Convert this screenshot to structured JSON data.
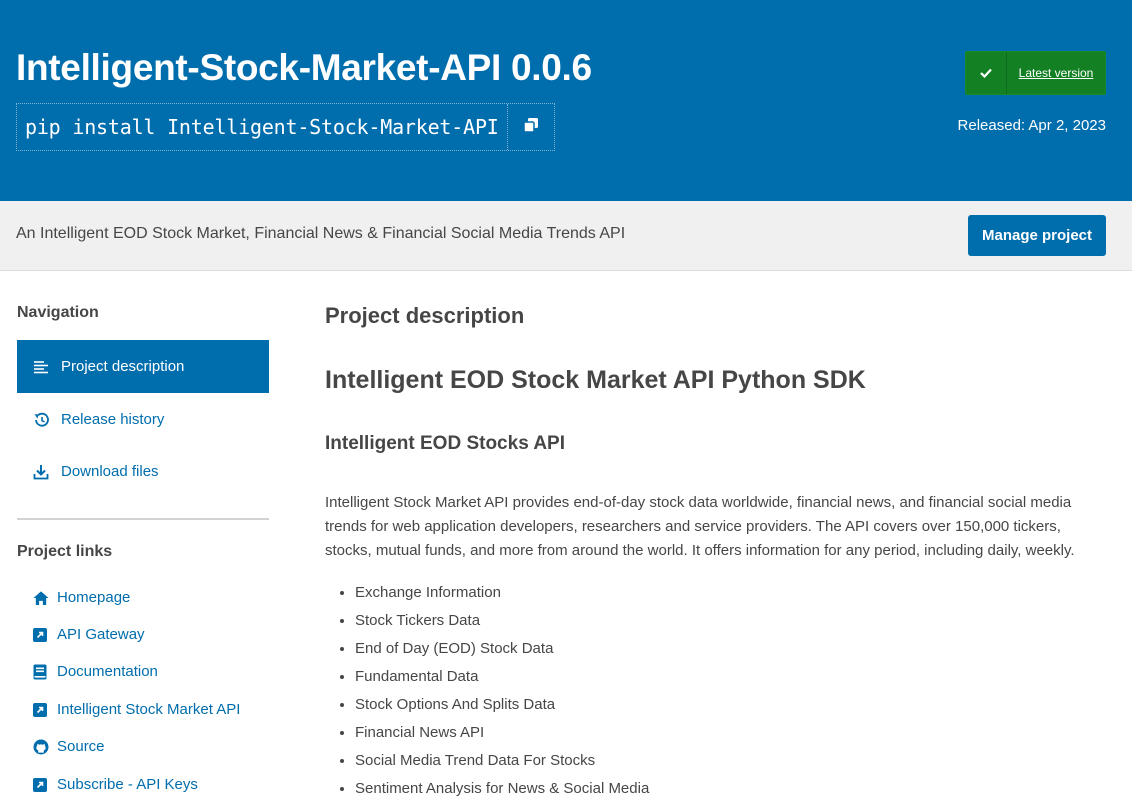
{
  "header": {
    "package_title": "Intelligent-Stock-Market-API 0.0.6",
    "pip_command": "pip install Intelligent-Stock-Market-API",
    "copy_icon": "copy-icon",
    "latest_badge": {
      "icon": "check-icon",
      "label": "Latest version"
    },
    "released": "Released: Apr 2, 2023"
  },
  "summary": {
    "text": "An Intelligent EOD Stock Market, Financial News & Financial Social Media Trends API",
    "manage_label": "Manage project"
  },
  "sidebar": {
    "navigation_heading": "Navigation",
    "nav_items": [
      {
        "label": "Project description",
        "icon": "align-left-icon",
        "active": true
      },
      {
        "label": "Release history",
        "icon": "history-icon",
        "active": false
      },
      {
        "label": "Download files",
        "icon": "download-icon",
        "active": false
      }
    ],
    "project_links_heading": "Project links",
    "project_links": [
      {
        "label": "Homepage",
        "icon": "home-icon"
      },
      {
        "label": "API Gateway",
        "icon": "external-link-icon"
      },
      {
        "label": "Documentation",
        "icon": "book-icon"
      },
      {
        "label": "Intelligent Stock Market API",
        "icon": "external-link-icon"
      },
      {
        "label": "Source",
        "icon": "github-icon"
      },
      {
        "label": "Subscribe - API Keys",
        "icon": "external-link-icon"
      }
    ]
  },
  "main": {
    "section_heading": "Project description",
    "sdk_heading": "Intelligent EOD Stock Market API Python SDK",
    "api_heading": "Intelligent EOD Stocks API",
    "intro": "Intelligent Stock Market API provides end-of-day stock data worldwide, financial news, and financial social media trends for web application developers, researchers and service providers. The API covers over 150,000 tickers, stocks, mutual funds, and more from around the world. It offers information for any period, including daily, weekly.",
    "features": [
      "Exchange Information",
      "Stock Tickers Data",
      "End of Day (EOD) Stock Data",
      "Fundamental Data",
      "Stock Options And Splits Data",
      "Financial News API",
      "Social Media Trend Data For Stocks",
      "Sentiment Analysis for News & Social Media"
    ]
  },
  "colors": {
    "brand_blue": "#006dad",
    "badge_green": "#148024",
    "summary_bg": "#f0f0f0",
    "text": "#464646"
  }
}
